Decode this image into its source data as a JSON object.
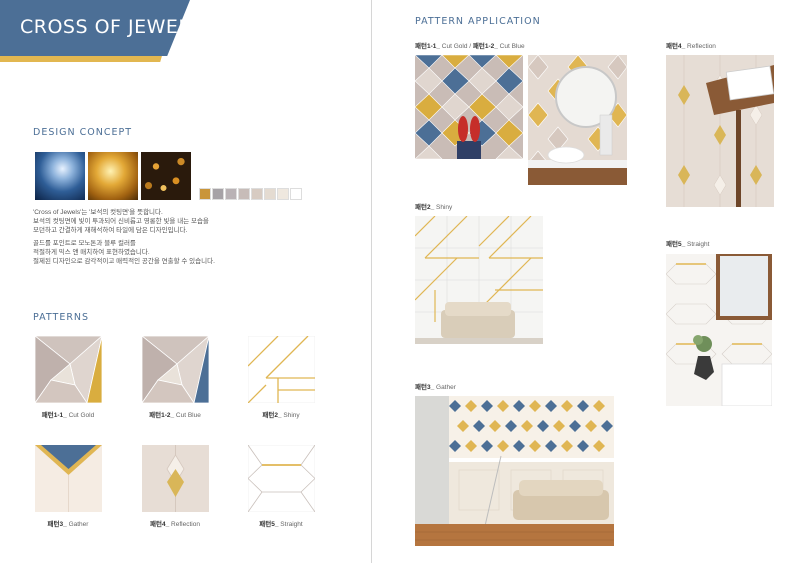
{
  "title": "CROSS OF JEWELS",
  "design_concept": {
    "heading": "DESIGN CONCEPT",
    "paragraph1": [
      "'Cross of Jewels'는 '보석의 컷팅면'을 뜻합니다.",
      "보석의 컷팅면에 빛이 투과되어 신비롭고 영롱한 빛을 내는 모습을",
      "모던하고 간결하게 재해석하여 타일에 담은 디자인입니다."
    ],
    "paragraph2": [
      "골드를 포인트로 모노톤과 블루 컬러를",
      "적절하게 믹스 앤 매치하여 표현하였습니다.",
      "절제된 디자인으로 감각적이고 매력적인 공간을 연출할 수 있습니다."
    ],
    "swatches": [
      "#c9953a",
      "#a6a2a6",
      "#b9b2b5",
      "#c7bcb8",
      "#d7cbc2",
      "#e4dbd1",
      "#efe8df",
      "#ffffff"
    ]
  },
  "patterns": {
    "heading": "PATTERNS",
    "items": [
      {
        "name": "패턴1-1_",
        "label": "Cut Gold"
      },
      {
        "name": "패턴1-2_",
        "label": "Cut Blue"
      },
      {
        "name": "패턴2_",
        "label": "Shiny"
      },
      {
        "name": "패턴3_",
        "label": "Gather"
      },
      {
        "name": "패턴4_",
        "label": "Reflection"
      },
      {
        "name": "패턴5_",
        "label": "Straight"
      }
    ]
  },
  "application": {
    "heading": "PATTERN APPLICATION",
    "cap1_name_a": "패턴1-1_",
    "cap1_label_a": "Cut Gold / ",
    "cap1_name_b": "패턴1-2_",
    "cap1_label_b": "Cut Blue",
    "cap2_name": "패턴2_",
    "cap2_label": "Shiny",
    "cap3_name": "패턴3_",
    "cap3_label": "Gather",
    "cap4_name": "패턴4_",
    "cap4_label": "Reflection",
    "cap5_name": "패턴5_",
    "cap5_label": "Straight"
  },
  "colors": {
    "blue": "#4c6f96",
    "gold": "#e2b750",
    "tile_gray": "#c9bcb6"
  }
}
